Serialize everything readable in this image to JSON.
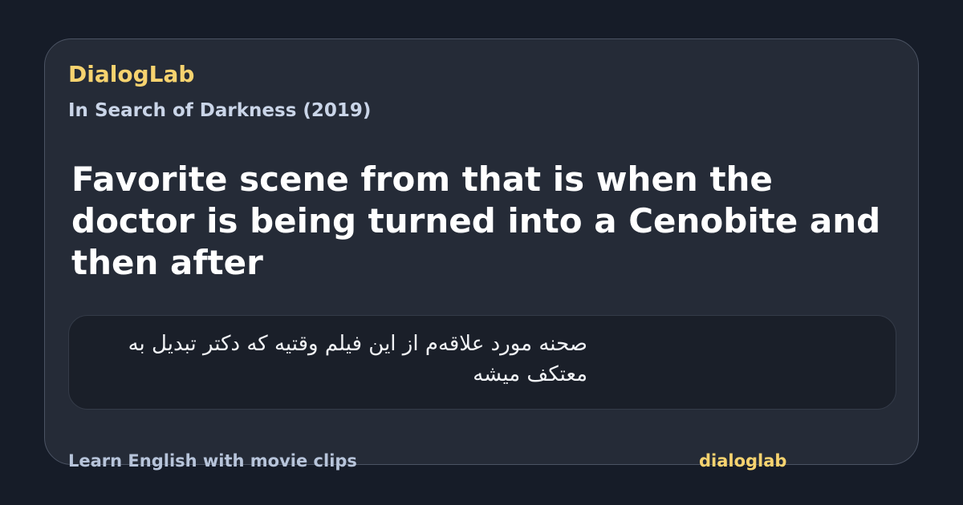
{
  "brand": {
    "name": "DialogLab",
    "handle": "dialoglab"
  },
  "movie": {
    "title": "In Search of Darkness (2019)"
  },
  "quote": {
    "english": "Favorite scene from that is when the doctor is being turned into a Cenobite and then after",
    "translation": "صحنه مورد علاقه‌م از این فیلم وقتیه که دکتر تبدیل به معتکف میشه"
  },
  "footer": {
    "tagline": "Learn English with movie clips"
  },
  "colors": {
    "background": "#161c28",
    "card": "#252b37",
    "accent": "#f7d36f",
    "translation_box": "#1a1f29"
  }
}
